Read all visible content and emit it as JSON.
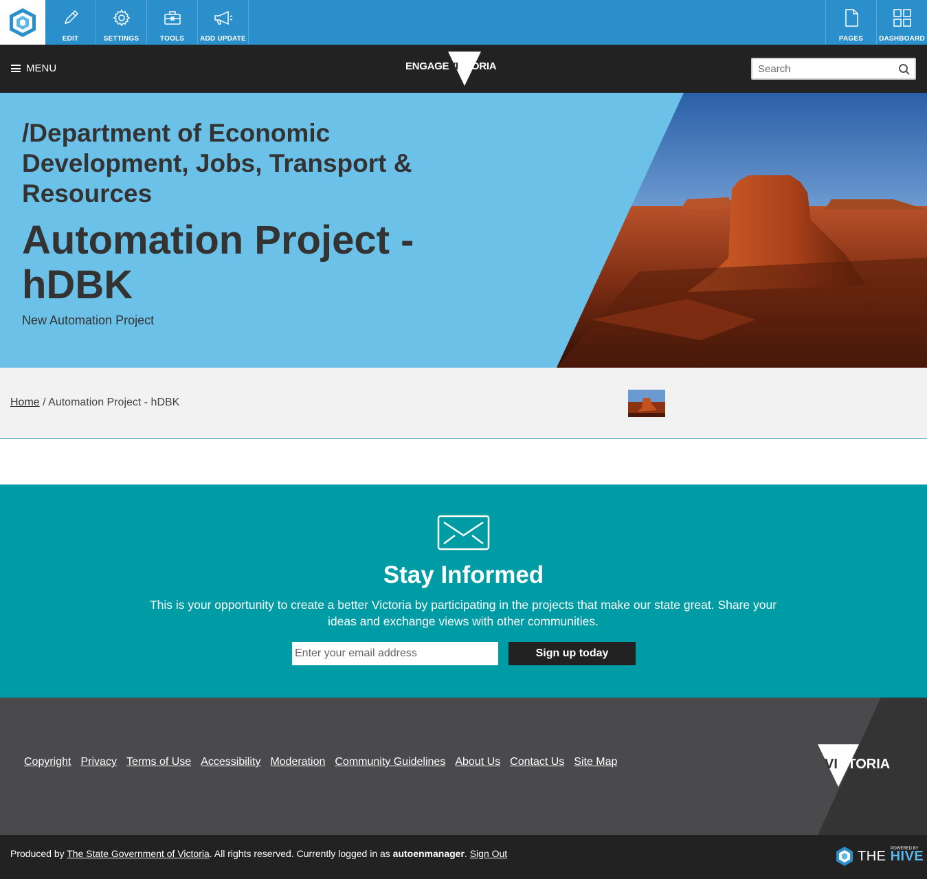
{
  "admin_bar": {
    "left_buttons": [
      {
        "label": "EDIT",
        "icon": "pencil-icon"
      },
      {
        "label": "SETTINGS",
        "icon": "gear-icon"
      },
      {
        "label": "TOOLS",
        "icon": "toolbox-icon"
      },
      {
        "label": "ADD UPDATE",
        "icon": "megaphone-icon"
      }
    ],
    "right_buttons": [
      {
        "label": "PAGES",
        "icon": "page-icon"
      },
      {
        "label": "DASHBOARD",
        "icon": "grid-icon"
      }
    ],
    "color": "#2b8fcc"
  },
  "header": {
    "menu_label": "MENU",
    "brand_left": "ENGAGE",
    "brand_right": "VICTORIA",
    "brand_right_dark": "VI",
    "brand_right_light": "CTORIA",
    "search_placeholder": "Search"
  },
  "hero": {
    "department": "/Department of Economic Development, Jobs, Transport & Resources",
    "title": "Automation Project - hDBK",
    "subtitle": "New Automation Project",
    "bg_color": "#6cc1e8"
  },
  "breadcrumb": {
    "home": "Home",
    "separator": "/",
    "current": "Automation Project - hDBK"
  },
  "newsletter": {
    "title": "Stay Informed",
    "text": "This is your opportunity to create a better Victoria by participating in the projects that make our state great. Share your ideas and exchange views with other communities.",
    "email_placeholder": "Enter your email address",
    "button_label": "Sign up today",
    "bg_color": "#009ca6"
  },
  "footer": {
    "links": [
      "Copyright",
      "Privacy",
      "Terms of Use",
      "Accessibility",
      "Moderation",
      "Community Guidelines",
      "About Us",
      "Contact Us",
      "Site Map"
    ],
    "logo_dark": "VI",
    "logo_light": "CTORIA"
  },
  "bottom": {
    "produced_by": "Produced by",
    "gov_link": "The State Government of Victoria",
    "rights": ".   All rights reserved.   Currently logged in as",
    "username": "autoenmanager",
    "sign_out": "Sign Out",
    "powered_by": "POWERED BY",
    "hive_the": "THE",
    "hive_name": "HIVE"
  }
}
